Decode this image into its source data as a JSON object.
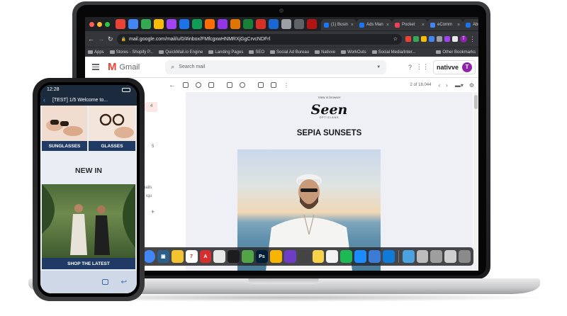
{
  "browser": {
    "tabs": [
      {
        "label": "(1) Busin",
        "color": "#1877f2"
      },
      {
        "label": "Ads Man",
        "color": "#1877f2"
      },
      {
        "label": "Pocket",
        "color": "#ef4056"
      },
      {
        "label": "eComm",
        "color": "#4285f4"
      },
      {
        "label": "About -",
        "color": "#1a73e8"
      }
    ],
    "new_tab": "+",
    "url": "mail.google.com/mail/u/0/#inbox/FMfcgxwHNMRXjGgCrvcNDFrl",
    "bookmarks": [
      "Apps",
      "Stores - Shopify P...",
      "QuickMail.io Engine",
      "Landing Pages",
      "SEO",
      "Social Ad Bureau",
      "Nativve",
      "WorkOuts",
      "Social Media/Inter..."
    ],
    "other_bookmarks": "Other Bookmarks"
  },
  "gmail": {
    "logo_text": "Gmail",
    "search_placeholder": "Search mail",
    "brand_label": "nativve",
    "avatar_letter": "T",
    "pager": "2 of 18,044",
    "sidebar_counts": [
      "4",
      "5"
    ],
    "sidebar_fragment": "nails",
    "sidebar_fragment2": "iqu"
  },
  "email": {
    "preheader": "View in browser",
    "logo": "Seen",
    "logo_sub": "OPTICIANS",
    "headline": "SEPIA SUNSETS"
  },
  "phone": {
    "time": "12:28",
    "subject": "[TEST] 1/5 Welcome to...",
    "category_left": "SUNGLASSES",
    "category_right": "GLASSES",
    "section_title": "NEW IN",
    "cta": "SHOP THE LATEST"
  },
  "dock_apps": [
    {
      "name": "chrome-app",
      "color": "#4285f4",
      "glyph": ""
    },
    {
      "name": "preview-app",
      "color": "#2d5f8b",
      "glyph": "▣"
    },
    {
      "name": "cyberduck-app",
      "color": "#f4c430",
      "glyph": ""
    },
    {
      "name": "calendar-app",
      "color": "#ffffff",
      "glyph": "7"
    },
    {
      "name": "acrobat-app",
      "color": "#d32f2f",
      "glyph": "A"
    },
    {
      "name": "finder-app",
      "color": "#e8e8e8",
      "glyph": ""
    },
    {
      "name": "xcode-app",
      "color": "#1c1c1e",
      "glyph": ""
    },
    {
      "name": "green-app",
      "color": "#52a447",
      "glyph": ""
    },
    {
      "name": "photoshop-app",
      "color": "#001e36",
      "glyph": "Ps"
    },
    {
      "name": "sketch-app",
      "color": "#f7b500",
      "glyph": ""
    },
    {
      "name": "purple-app",
      "color": "#6e3cc6",
      "glyph": ""
    },
    {
      "name": "monitor-app",
      "color": "#444444",
      "glyph": ""
    },
    {
      "name": "notes-app",
      "color": "#f7d24a",
      "glyph": ""
    },
    {
      "name": "notes2-app",
      "color": "#f3f3f3",
      "glyph": ""
    },
    {
      "name": "spotify-app",
      "color": "#1db954",
      "glyph": ""
    },
    {
      "name": "appstore-app",
      "color": "#1a8cff",
      "glyph": ""
    },
    {
      "name": "keynote-app",
      "color": "#3b7bd6",
      "glyph": ""
    },
    {
      "name": "edge-app",
      "color": "#0f7bd8",
      "glyph": ""
    },
    {
      "name": "folder-app",
      "color": "#4aa3df",
      "glyph": ""
    },
    {
      "name": "disk-app",
      "color": "#bdbdbd",
      "glyph": ""
    },
    {
      "name": "mail-app",
      "color": "#9e9e9e",
      "glyph": ""
    },
    {
      "name": "downloads-app",
      "color": "#cfcfcf",
      "glyph": ""
    },
    {
      "name": "trash-app",
      "color": "#8a8a8a",
      "glyph": ""
    }
  ]
}
